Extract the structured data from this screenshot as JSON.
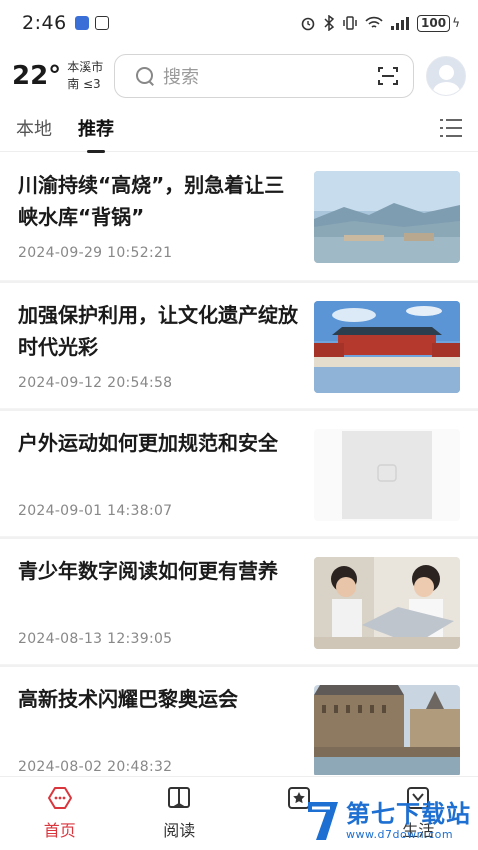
{
  "status_bar": {
    "time": "2:46",
    "battery": "100"
  },
  "header": {
    "temperature": "22°",
    "city": "本溪市",
    "wind": "南 ≤3",
    "search_placeholder": "搜索"
  },
  "tabs": [
    {
      "label": "本地",
      "active": false
    },
    {
      "label": "推荐",
      "active": true
    }
  ],
  "news": [
    {
      "title": "川渝持续“高烧”，别急着让三峡水库“背锅”",
      "date": "2024-09-29 10:52:21",
      "thumb": "river-landscape"
    },
    {
      "title": "加强保护利用，让文化遗产绽放时代光彩",
      "date": "2024-09-12 20:54:58",
      "thumb": "palace"
    },
    {
      "title": "户外运动如何更加规范和安全",
      "date": "2024-09-01 14:38:07",
      "thumb": "placeholder"
    },
    {
      "title": "青少年数字阅读如何更有营养",
      "date": "2024-08-13 12:39:05",
      "thumb": "children-laptop"
    },
    {
      "title": "高新技术闪耀巴黎奥运会",
      "date": "2024-08-02 20:48:32",
      "thumb": "paris-building"
    }
  ],
  "bottom_nav": [
    {
      "label": "首页",
      "icon": "home-icon",
      "active": true
    },
    {
      "label": "阅读",
      "icon": "book-icon",
      "active": false
    },
    {
      "label": "",
      "icon": "star-icon",
      "active": false
    },
    {
      "label": "生活",
      "icon": "life-icon",
      "active": false
    }
  ],
  "watermark": {
    "name": "第七下载站",
    "url": "www.d7down.com"
  },
  "colors": {
    "accent": "#d9363e",
    "watermark": "#1d6fd1"
  }
}
